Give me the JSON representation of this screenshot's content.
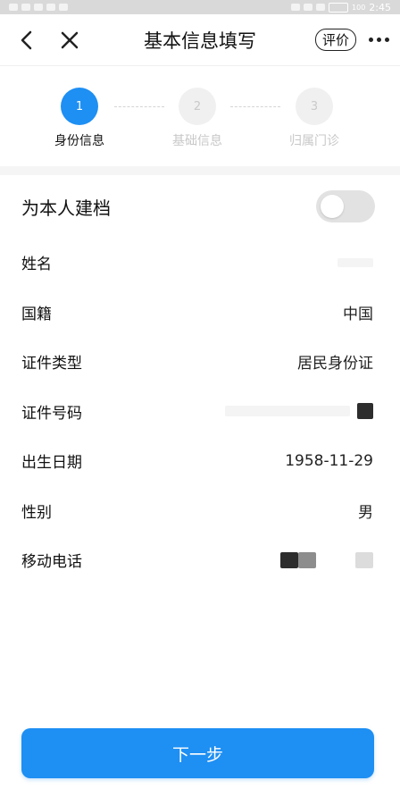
{
  "status_bar": {
    "time": "2:45",
    "battery": "100"
  },
  "nav": {
    "title": "基本信息填写",
    "rate_label": "评价"
  },
  "steps": [
    {
      "number": "1",
      "label": "身份信息",
      "active": true
    },
    {
      "number": "2",
      "label": "基础信息",
      "active": false
    },
    {
      "number": "3",
      "label": "归属门诊",
      "active": false
    }
  ],
  "self_record": {
    "label": "为本人建档",
    "enabled": false
  },
  "form": {
    "name": {
      "label": "姓名"
    },
    "nationality": {
      "label": "国籍",
      "value": "中国"
    },
    "id_type": {
      "label": "证件类型",
      "value": "居民身份证"
    },
    "id_number": {
      "label": "证件号码"
    },
    "birth_date": {
      "label": "出生日期",
      "value": "1958-11-29"
    },
    "gender": {
      "label": "性别",
      "value": "男"
    },
    "mobile": {
      "label": "移动电话"
    }
  },
  "next_button": {
    "label": "下一步"
  },
  "colors": {
    "accent": "#1e8ff3",
    "inactive_step": "#f0f0f0"
  }
}
